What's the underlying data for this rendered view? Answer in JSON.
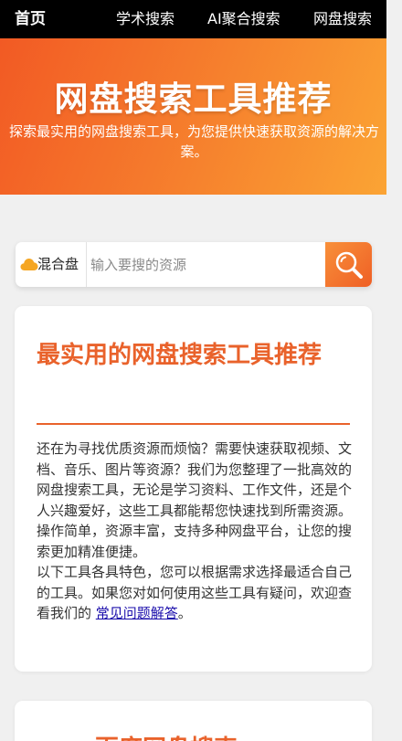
{
  "nav": {
    "home": "首页",
    "academic_search": "学术搜索",
    "ai_search": "AI聚合搜索",
    "netdisk_search": "网盘搜索"
  },
  "hero": {
    "title": "网盘搜索工具推荐",
    "subtitle": "探索最实用的网盘搜索工具，为您提供快速获取资源的解决方案。"
  },
  "search": {
    "type_icon": "cloud-icon",
    "type_label": "混合盘",
    "placeholder": "输入要搜的资源",
    "value": "",
    "button_icon": "search-icon"
  },
  "intro_card": {
    "title": "最实用的网盘搜索工具推荐",
    "paragraph1": "还在为寻找优质资源而烦恼？需要快速获取视频、文档、音乐、图片等资源？我们为您整理了一批高效的网盘搜索工具，无论是学习资料、工作文件，还是个人兴趣爱好，这些工具都能帮您快速找到所需资源。操作简单，资源丰富，支持多种网盘平台，让您的搜索更加精准便捷。",
    "paragraph2_prefix": "以下工具各具特色，您可以根据需求选择最适合自己的工具。如果您对如何使用这些工具有疑问，欢迎查看我们的 ",
    "faq_link": "常见问题解答",
    "paragraph2_suffix": "。"
  },
  "second_card": {
    "title": "百度网盘搜索"
  },
  "colors": {
    "nav_bg": "#000000",
    "hero_gradient_start": "#f25a24",
    "hero_gradient_end": "#fba434",
    "accent": "#e9622b",
    "link": "#1a0dab",
    "page_bg": "#f0f0f0"
  }
}
